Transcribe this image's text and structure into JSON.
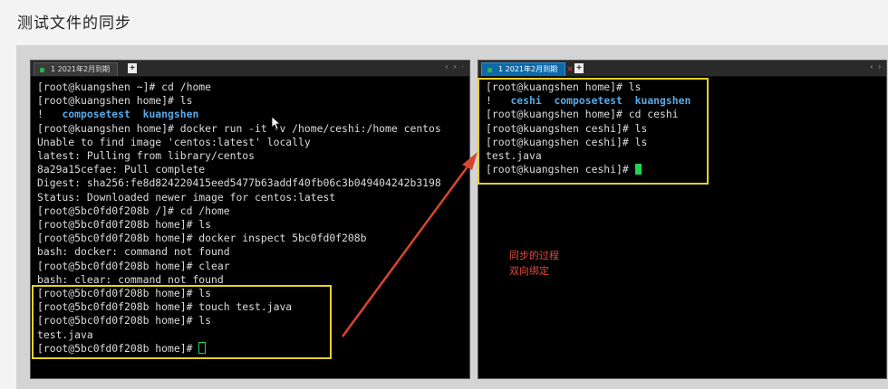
{
  "page": {
    "title": "测试文件的同步"
  },
  "left_pane": {
    "tab_label": "1 2021年2月到期",
    "nav": "‹ › ·",
    "lines": [
      [
        {
          "t": "[root@kuangshen ~]# cd /home"
        }
      ],
      [
        {
          "t": "[root@kuangshen home]# ls"
        }
      ],
      [
        {
          "t": "!   "
        },
        {
          "t": "composetest",
          "c": "hl"
        },
        {
          "t": "  "
        },
        {
          "t": "kuangshen",
          "c": "hl"
        }
      ],
      [
        {
          "t": "[root@kuangshen home]# docker run -it -v /home/ceshi:/home centos"
        }
      ],
      [
        {
          "t": "Unable to find image 'centos:latest' locally"
        }
      ],
      [
        {
          "t": "latest: Pulling from library/centos"
        }
      ],
      [
        {
          "t": "8a29a15cefae: Pull complete"
        }
      ],
      [
        {
          "t": "Digest: sha256:fe8d824220415eed5477b63addf40fb06c3b049404242b3198"
        }
      ],
      [
        {
          "t": "Status: Downloaded newer image for centos:latest"
        }
      ],
      [
        {
          "t": "[root@5bc0fd0f208b /]# cd /home"
        }
      ],
      [
        {
          "t": "[root@5bc0fd0f208b home]# ls"
        }
      ],
      [
        {
          "t": "[root@5bc0fd0f208b home]# docker inspect 5bc0fd0f208b"
        }
      ],
      [
        {
          "t": "bash: docker: command not found"
        }
      ],
      [
        {
          "t": "[root@5bc0fd0f208b home]# clear"
        }
      ],
      [
        {
          "t": "bash: clear: command not found"
        }
      ],
      [
        {
          "t": "[root@5bc0fd0f208b home]# ls"
        }
      ],
      [
        {
          "t": "[root@5bc0fd0f208b home]# touch test.java"
        }
      ],
      [
        {
          "t": "[root@5bc0fd0f208b home]# ls"
        }
      ],
      [
        {
          "t": "test.java"
        }
      ],
      [
        {
          "t": "[root@5bc0fd0f208b home]# "
        },
        {
          "cursor": "hollow"
        }
      ]
    ]
  },
  "right_pane": {
    "tab_label": "1 2021年2月到期",
    "nav": "‹ ›",
    "lines": [
      [
        {
          "t": "[root@kuangshen home]# ls"
        }
      ],
      [
        {
          "t": "!   "
        },
        {
          "t": "ceshi",
          "c": "hl"
        },
        {
          "t": "  "
        },
        {
          "t": "composetest",
          "c": "hl"
        },
        {
          "t": "  "
        },
        {
          "t": "kuangshen",
          "c": "hl"
        }
      ],
      [
        {
          "t": "[root@kuangshen home]# cd ceshi"
        }
      ],
      [
        {
          "t": "[root@kuangshen ceshi]# ls"
        }
      ],
      [
        {
          "t": "[root@kuangshen ceshi]# ls"
        }
      ],
      [
        {
          "t": "test.java"
        }
      ],
      [
        {
          "t": "[root@kuangshen ceshi]# "
        },
        {
          "cursor": "solid"
        }
      ]
    ]
  },
  "annotation": {
    "line1": "同步的过程",
    "line2": "双向绑定",
    "color": "#e24a3a",
    "box_color": "#e6d22a"
  },
  "icons": {
    "tab_add": "+",
    "tab_close": "×"
  }
}
